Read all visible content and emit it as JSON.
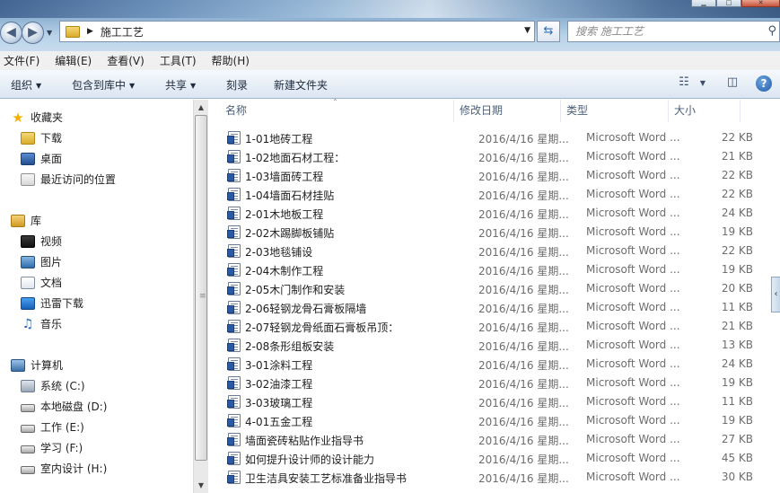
{
  "window": {
    "title_path": "施工工艺",
    "search_placeholder": "搜索 施工工艺"
  },
  "menubar": [
    "文件(F)",
    "编辑(E)",
    "查看(V)",
    "工具(T)",
    "帮助(H)"
  ],
  "toolbar": {
    "organize": "组织",
    "include_in_library": "包含到库中",
    "share": "共享",
    "burn": "刻录",
    "new_folder": "新建文件夹"
  },
  "nav": {
    "favorites": "收藏夹",
    "downloads": "下载",
    "desktop": "桌面",
    "recent": "最近访问的位置",
    "libraries": "库",
    "videos": "视频",
    "pictures": "图片",
    "documents": "文档",
    "thunder": "迅雷下载",
    "music": "音乐",
    "computer": "计算机",
    "drive_c": "系统 (C:)",
    "drive_d": "本地磁盘 (D:)",
    "drive_e": "工作 (E:)",
    "drive_f": "学习 (F:)",
    "drive_h": "室内设计 (H:)"
  },
  "columns": {
    "name": "名称",
    "date": "修改日期",
    "type": "类型",
    "size": "大小"
  },
  "files": [
    {
      "name": "1-01地砖工程",
      "date": "2016/4/16 星期...",
      "type": "Microsoft Word ...",
      "size": "22 KB"
    },
    {
      "name": "1-02地面石材工程：",
      "date": "2016/4/16 星期...",
      "type": "Microsoft Word ...",
      "size": "21 KB"
    },
    {
      "name": "1-03墙面砖工程",
      "date": "2016/4/16 星期...",
      "type": "Microsoft Word ...",
      "size": "22 KB"
    },
    {
      "name": "1-04墙面石材挂贴",
      "date": "2016/4/16 星期...",
      "type": "Microsoft Word ...",
      "size": "22 KB"
    },
    {
      "name": "2-01木地板工程",
      "date": "2016/4/16 星期...",
      "type": "Microsoft Word ...",
      "size": "24 KB"
    },
    {
      "name": "2-02木踢脚板铺贴",
      "date": "2016/4/16 星期...",
      "type": "Microsoft Word ...",
      "size": "19 KB"
    },
    {
      "name": "2-03地毯铺设",
      "date": "2016/4/16 星期...",
      "type": "Microsoft Word ...",
      "size": "22 KB"
    },
    {
      "name": "2-04木制作工程",
      "date": "2016/4/16 星期...",
      "type": "Microsoft Word ...",
      "size": "19 KB"
    },
    {
      "name": "2-05木门制作和安装",
      "date": "2016/4/16 星期...",
      "type": "Microsoft Word ...",
      "size": "20 KB"
    },
    {
      "name": "2-06轻钢龙骨石膏板隔墙",
      "date": "2016/4/16 星期...",
      "type": "Microsoft Word ...",
      "size": "11 KB"
    },
    {
      "name": "2-07轻钢龙骨纸面石膏板吊顶：",
      "date": "2016/4/16 星期...",
      "type": "Microsoft Word ...",
      "size": "21 KB"
    },
    {
      "name": "2-08条形组板安装",
      "date": "2016/4/16 星期...",
      "type": "Microsoft Word ...",
      "size": "13 KB"
    },
    {
      "name": "3-01涂料工程",
      "date": "2016/4/16 星期...",
      "type": "Microsoft Word ...",
      "size": "24 KB"
    },
    {
      "name": "3-02油漆工程",
      "date": "2016/4/16 星期...",
      "type": "Microsoft Word ...",
      "size": "19 KB"
    },
    {
      "name": "3-03玻璃工程",
      "date": "2016/4/16 星期...",
      "type": "Microsoft Word ...",
      "size": "11 KB"
    },
    {
      "name": "4-01五金工程",
      "date": "2016/4/16 星期...",
      "type": "Microsoft Word ...",
      "size": "19 KB"
    },
    {
      "name": "墙面瓷砖粘贴作业指导书",
      "date": "2016/4/16 星期...",
      "type": "Microsoft Word ...",
      "size": "27 KB"
    },
    {
      "name": "如何提升设计师的设计能力",
      "date": "2016/4/16 星期...",
      "type": "Microsoft Word ...",
      "size": "45 KB"
    },
    {
      "name": "卫生洁具安装工艺标准备业指导书",
      "date": "2016/4/16 星期...",
      "type": "Microsoft Word ...",
      "size": "30 KB"
    }
  ]
}
